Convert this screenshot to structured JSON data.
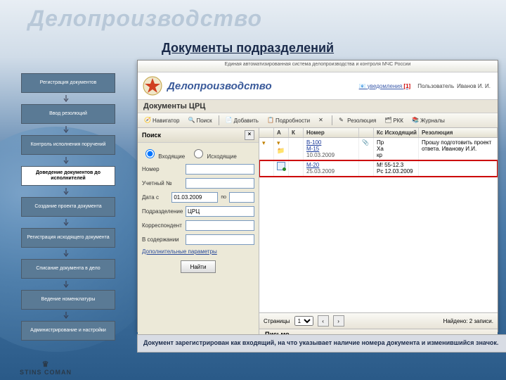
{
  "slide": {
    "watermark": "Делопроизводство",
    "subtitle": "Документы подразделений",
    "caption": "Документ зарегистрирован как входящий, на что указывает наличие номера документа и изменившийся значок.",
    "footer": "STINS  COMAN"
  },
  "nav": {
    "items": [
      {
        "label": "Регистрация документов",
        "active": false
      },
      {
        "label": "Ввод резолюций",
        "active": false
      },
      {
        "label": "Контроль исполнения поручений",
        "active": false
      },
      {
        "label": "Доведение документов до исполнителей",
        "active": true
      },
      {
        "label": "Создание проекта документа",
        "active": false
      },
      {
        "label": "Регистрация исходящего документа",
        "active": false
      },
      {
        "label": "Списание документа в дело",
        "active": false
      },
      {
        "label": "Ведение номенклатуры",
        "active": false
      },
      {
        "label": "Администрирование и настройки",
        "active": false
      }
    ]
  },
  "app": {
    "top_banner": "Единая автоматизированная система делопроизводства и контроля МЧС России",
    "title": "Делопроизводство",
    "notif_label": "уведомления",
    "notif_count": "[1]",
    "user_label": "Пользователь",
    "user_name": "Иванов И. И.",
    "subheader": "Документы ЦРЦ",
    "toolbar": {
      "navigator": "Навигатор",
      "search": "Поиск",
      "add": "Добавить",
      "details": "Подробности",
      "delete_icon": "✕",
      "resolution": "Резолюция",
      "rkk": "РКК",
      "journals": "Журналы"
    },
    "search_panel": {
      "title": "Поиск",
      "radio_in": "Входящие",
      "radio_out": "Исходящие",
      "f_number": "Номер",
      "f_uchet": "Учетный №",
      "f_date": "Дата с",
      "f_date_val": "01.03.2009",
      "f_date_to": "по",
      "f_dept": "Подразделение",
      "f_dept_val": "ЦРЦ",
      "f_corr": "Корреспондент",
      "f_content": "В содержании",
      "extra": "Дополнительные параметры",
      "find": "Найти"
    },
    "grid": {
      "cols": {
        "c1": "",
        "c2": "А",
        "c3": "К",
        "c4": "Номер",
        "c5": "",
        "c6": "Кс Исходящий",
        "c7": "Резолюция"
      },
      "rows": [
        {
          "icon": "folder",
          "num": "В-100",
          "num2": "М-15",
          "date": "10.03.2009",
          "out1": "Пр",
          "out2": "Ха",
          "out3": "кр",
          "res": "Прошу подготовить проект ответа. Иванову И.И.",
          "sel": false
        },
        {
          "icon": "doc-reg",
          "num": "М-20",
          "date": "25.03.2009",
          "out1": "М! 55-12.3",
          "out2": "Рс 12.03.2009",
          "res": "",
          "sel": true
        }
      ]
    },
    "pager": {
      "label": "Страницы",
      "page": "1",
      "found": "Найдено: 2 записи."
    },
    "detail_tab": "Письмо"
  }
}
